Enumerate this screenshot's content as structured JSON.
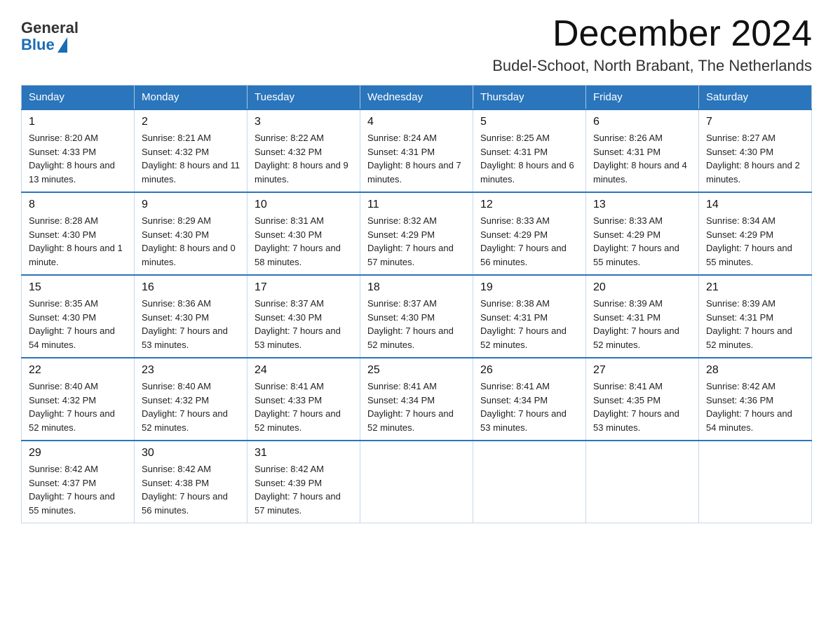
{
  "logo": {
    "general": "General",
    "blue": "Blue"
  },
  "header": {
    "month_title": "December 2024",
    "location": "Budel-Schoot, North Brabant, The Netherlands"
  },
  "weekdays": [
    "Sunday",
    "Monday",
    "Tuesday",
    "Wednesday",
    "Thursday",
    "Friday",
    "Saturday"
  ],
  "weeks": [
    [
      {
        "day": "1",
        "sunrise": "8:20 AM",
        "sunset": "4:33 PM",
        "daylight": "8 hours and 13 minutes."
      },
      {
        "day": "2",
        "sunrise": "8:21 AM",
        "sunset": "4:32 PM",
        "daylight": "8 hours and 11 minutes."
      },
      {
        "day": "3",
        "sunrise": "8:22 AM",
        "sunset": "4:32 PM",
        "daylight": "8 hours and 9 minutes."
      },
      {
        "day": "4",
        "sunrise": "8:24 AM",
        "sunset": "4:31 PM",
        "daylight": "8 hours and 7 minutes."
      },
      {
        "day": "5",
        "sunrise": "8:25 AM",
        "sunset": "4:31 PM",
        "daylight": "8 hours and 6 minutes."
      },
      {
        "day": "6",
        "sunrise": "8:26 AM",
        "sunset": "4:31 PM",
        "daylight": "8 hours and 4 minutes."
      },
      {
        "day": "7",
        "sunrise": "8:27 AM",
        "sunset": "4:30 PM",
        "daylight": "8 hours and 2 minutes."
      }
    ],
    [
      {
        "day": "8",
        "sunrise": "8:28 AM",
        "sunset": "4:30 PM",
        "daylight": "8 hours and 1 minute."
      },
      {
        "day": "9",
        "sunrise": "8:29 AM",
        "sunset": "4:30 PM",
        "daylight": "8 hours and 0 minutes."
      },
      {
        "day": "10",
        "sunrise": "8:31 AM",
        "sunset": "4:30 PM",
        "daylight": "7 hours and 58 minutes."
      },
      {
        "day": "11",
        "sunrise": "8:32 AM",
        "sunset": "4:29 PM",
        "daylight": "7 hours and 57 minutes."
      },
      {
        "day": "12",
        "sunrise": "8:33 AM",
        "sunset": "4:29 PM",
        "daylight": "7 hours and 56 minutes."
      },
      {
        "day": "13",
        "sunrise": "8:33 AM",
        "sunset": "4:29 PM",
        "daylight": "7 hours and 55 minutes."
      },
      {
        "day": "14",
        "sunrise": "8:34 AM",
        "sunset": "4:29 PM",
        "daylight": "7 hours and 55 minutes."
      }
    ],
    [
      {
        "day": "15",
        "sunrise": "8:35 AM",
        "sunset": "4:30 PM",
        "daylight": "7 hours and 54 minutes."
      },
      {
        "day": "16",
        "sunrise": "8:36 AM",
        "sunset": "4:30 PM",
        "daylight": "7 hours and 53 minutes."
      },
      {
        "day": "17",
        "sunrise": "8:37 AM",
        "sunset": "4:30 PM",
        "daylight": "7 hours and 53 minutes."
      },
      {
        "day": "18",
        "sunrise": "8:37 AM",
        "sunset": "4:30 PM",
        "daylight": "7 hours and 52 minutes."
      },
      {
        "day": "19",
        "sunrise": "8:38 AM",
        "sunset": "4:31 PM",
        "daylight": "7 hours and 52 minutes."
      },
      {
        "day": "20",
        "sunrise": "8:39 AM",
        "sunset": "4:31 PM",
        "daylight": "7 hours and 52 minutes."
      },
      {
        "day": "21",
        "sunrise": "8:39 AM",
        "sunset": "4:31 PM",
        "daylight": "7 hours and 52 minutes."
      }
    ],
    [
      {
        "day": "22",
        "sunrise": "8:40 AM",
        "sunset": "4:32 PM",
        "daylight": "7 hours and 52 minutes."
      },
      {
        "day": "23",
        "sunrise": "8:40 AM",
        "sunset": "4:32 PM",
        "daylight": "7 hours and 52 minutes."
      },
      {
        "day": "24",
        "sunrise": "8:41 AM",
        "sunset": "4:33 PM",
        "daylight": "7 hours and 52 minutes."
      },
      {
        "day": "25",
        "sunrise": "8:41 AM",
        "sunset": "4:34 PM",
        "daylight": "7 hours and 52 minutes."
      },
      {
        "day": "26",
        "sunrise": "8:41 AM",
        "sunset": "4:34 PM",
        "daylight": "7 hours and 53 minutes."
      },
      {
        "day": "27",
        "sunrise": "8:41 AM",
        "sunset": "4:35 PM",
        "daylight": "7 hours and 53 minutes."
      },
      {
        "day": "28",
        "sunrise": "8:42 AM",
        "sunset": "4:36 PM",
        "daylight": "7 hours and 54 minutes."
      }
    ],
    [
      {
        "day": "29",
        "sunrise": "8:42 AM",
        "sunset": "4:37 PM",
        "daylight": "7 hours and 55 minutes."
      },
      {
        "day": "30",
        "sunrise": "8:42 AM",
        "sunset": "4:38 PM",
        "daylight": "7 hours and 56 minutes."
      },
      {
        "day": "31",
        "sunrise": "8:42 AM",
        "sunset": "4:39 PM",
        "daylight": "7 hours and 57 minutes."
      },
      null,
      null,
      null,
      null
    ]
  ]
}
